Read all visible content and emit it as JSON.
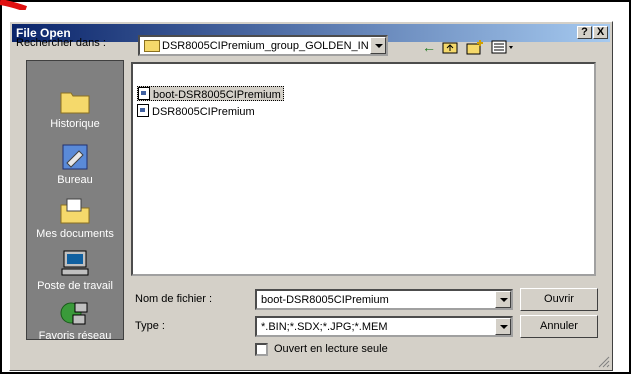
{
  "window": {
    "title": "File Open",
    "help_label": "?",
    "close_label": "X"
  },
  "lookin": {
    "label": "Rechercher dans :",
    "value": "DSR8005CIPremium_group_GOLDEN_IN"
  },
  "places": [
    {
      "label": "Historique",
      "icon": "history-icon"
    },
    {
      "label": "Bureau",
      "icon": "desktop-icon"
    },
    {
      "label": "Mes documents",
      "icon": "my-documents-icon"
    },
    {
      "label": "Poste de travail",
      "icon": "my-computer-icon"
    },
    {
      "label": "Favoris réseau",
      "icon": "network-places-icon"
    }
  ],
  "files": [
    {
      "name": "boot-DSR8005CIPremium",
      "selected": true
    },
    {
      "name": "DSR8005CIPremium",
      "selected": false
    }
  ],
  "filename": {
    "label": "Nom de fichier :",
    "value": "boot-DSR8005CIPremium"
  },
  "filetype": {
    "label": "Type :",
    "value": "*.BIN;*.SDX;*.JPG;*.MEM"
  },
  "readonly": {
    "label": "Ouvert en lecture seule",
    "checked": false
  },
  "buttons": {
    "open": "Ouvrir",
    "cancel": "Annuler"
  },
  "colors": {
    "titlebar_start": "#0a246a",
    "titlebar_end": "#a6caf0",
    "dialog_face": "#d4d0c8",
    "places_bar": "#808080"
  }
}
